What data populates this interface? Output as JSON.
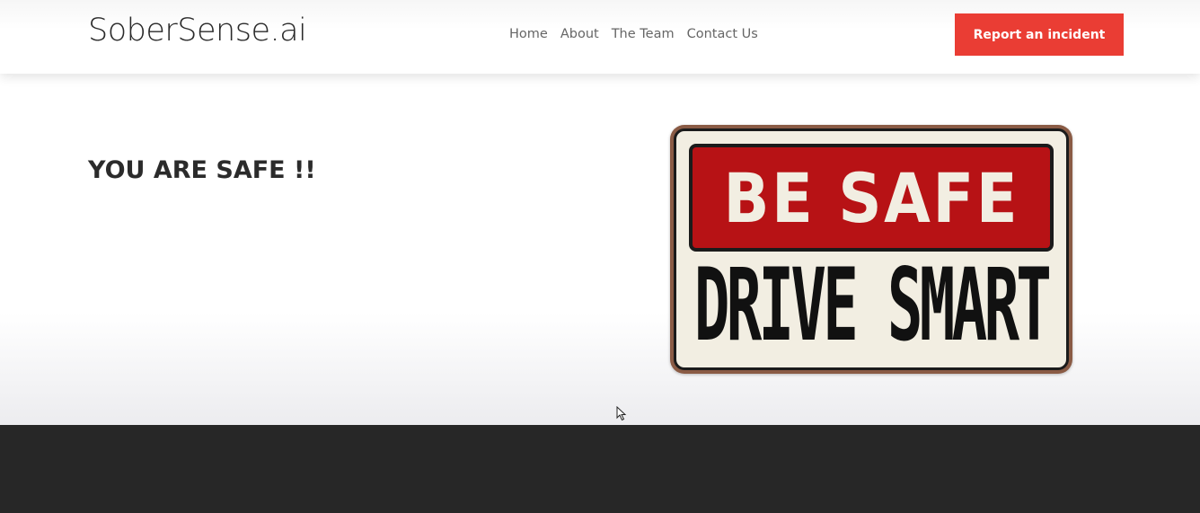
{
  "header": {
    "brand": "SoberSense.ai",
    "nav": [
      {
        "label": "Home"
      },
      {
        "label": "About"
      },
      {
        "label": "The Team"
      },
      {
        "label": "Contact Us"
      }
    ],
    "cta_label": "Report an incident"
  },
  "hero": {
    "title": "YOU ARE SAFE !!",
    "sign": {
      "line1": "BE SAFE",
      "line2": "DRIVE SMART"
    }
  },
  "colors": {
    "accent": "#ea3d34",
    "footer": "#272727",
    "sign_red": "#b71215"
  },
  "icons": [
    "mouse-cursor-icon"
  ]
}
